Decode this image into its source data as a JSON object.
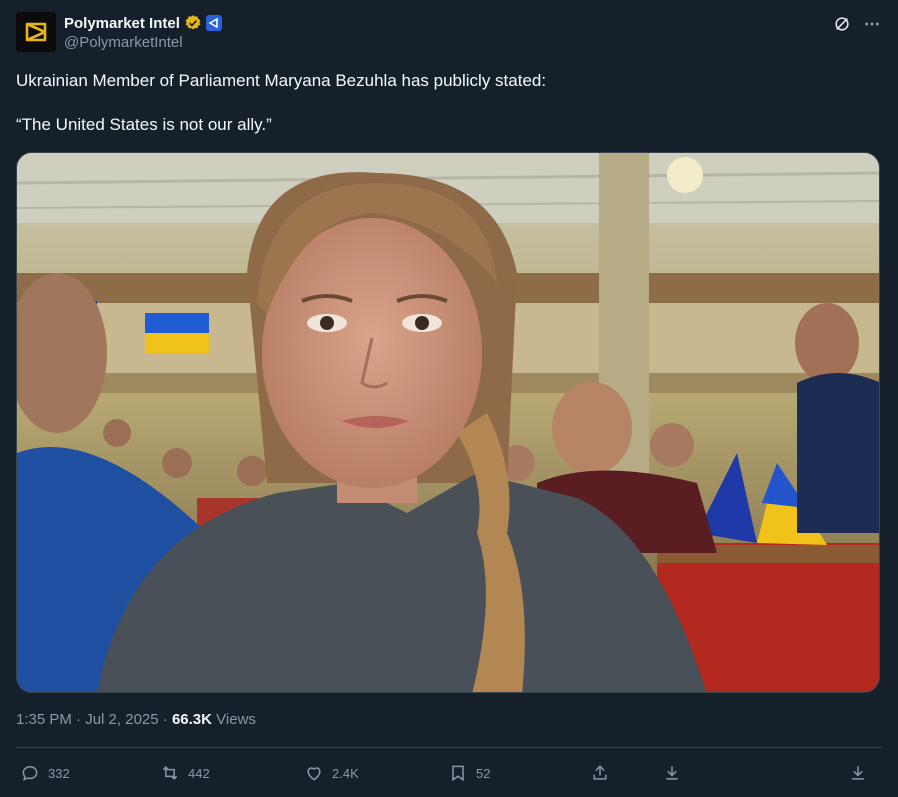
{
  "author": {
    "display_name": "Polymarket Intel",
    "handle": "@PolymarketIntel"
  },
  "tweet": {
    "text_line1": "Ukrainian Member of Parliament Maryana Bezuhla has publicly stated:",
    "text_line2": "“The United States is not our ally.”"
  },
  "meta": {
    "time": "1:35 PM",
    "separator1": "·",
    "date": "Jul 2, 2025",
    "separator2": "·",
    "views_count": "66.3K",
    "views_label": "Views"
  },
  "actions": {
    "reply_count": "332",
    "repost_count": "442",
    "like_count": "2.4K",
    "bookmark_count": "52"
  },
  "icons": [
    "verified-badge-icon",
    "affiliate-badge-icon",
    "grok-icon",
    "more-icon",
    "reply-icon",
    "repost-icon",
    "like-icon",
    "bookmark-icon",
    "share-icon",
    "download-icon",
    "download-icon"
  ],
  "colors": {
    "background": "#15202b",
    "muted": "#8b98a5",
    "verified": "#e8b31c",
    "border": "#38444d"
  }
}
